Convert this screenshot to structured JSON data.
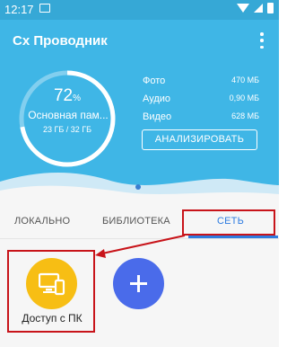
{
  "status_bar": {
    "time": "12:17",
    "icons": [
      "gallery-icon",
      "wifi-icon",
      "signal-icon",
      "battery-icon"
    ]
  },
  "app": {
    "title": "Cx Проводник",
    "menu_icon": "more-vertical-icon"
  },
  "storage": {
    "percent": "72",
    "percent_symbol": "%",
    "percent_value": 72,
    "label": "Основная пам...",
    "usage": "23 ГБ / 32 ГБ"
  },
  "stats": [
    {
      "label": "Фото",
      "value": "470 МБ"
    },
    {
      "label": "Аудио",
      "value": "0,90 МБ"
    },
    {
      "label": "Видео",
      "value": "628 МБ"
    }
  ],
  "analyze_button": "АНАЛИЗИРОВАТЬ",
  "tabs": [
    {
      "label": "ЛОКАЛЬНО",
      "active": false
    },
    {
      "label": "БИБЛИОТЕКА",
      "active": false
    },
    {
      "label": "СЕТЬ",
      "active": true
    }
  ],
  "network_items": [
    {
      "label": "Доступ с ПК",
      "icon": "pc-access-icon",
      "color": "#f7be14"
    },
    {
      "label": "",
      "icon": "plus-icon",
      "color": "#4a6bea"
    }
  ],
  "colors": {
    "header": "#3fb6e6",
    "accent": "#2e7ce0",
    "annotation": "#c8141a"
  }
}
